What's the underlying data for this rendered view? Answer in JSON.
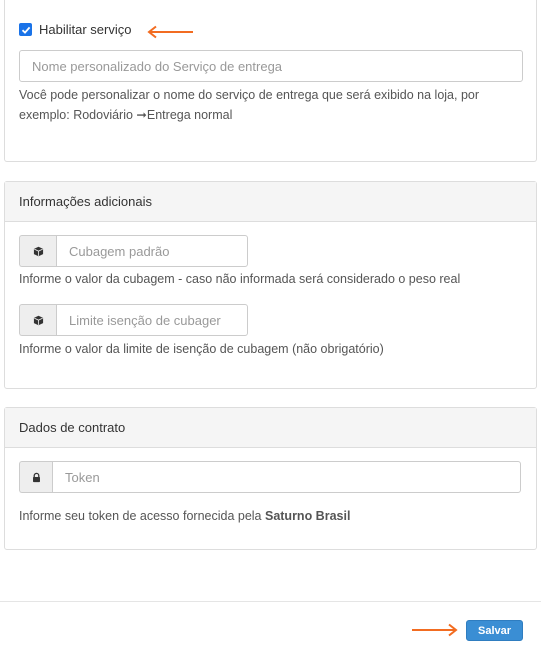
{
  "service": {
    "enable_label": "Habilitar serviço",
    "enabled": true,
    "name_placeholder": "Nome personalizado do Serviço de entrega",
    "name_help_line1": "Você pode personalizar o nome do serviço de entrega que será exibido na loja, por",
    "name_help_line2": "exemplo: Rodoviário ➞Entrega normal"
  },
  "additional": {
    "title": "Informações adicionais",
    "cubage_placeholder": "Cubagem padrão",
    "cubage_help": "Informe o valor da cubagem - caso não informada será considerado o peso real",
    "exemption_placeholder": "Limite isenção de cubager",
    "exemption_help": "Informe o valor da limite de isenção de cubagem (não obrigatório)",
    "icon": "cube-icon"
  },
  "contract": {
    "title": "Dados de contrato",
    "token_placeholder": "Token",
    "token_help_prefix": "Informe seu token de acesso fornecida pela ",
    "token_help_brand": "Saturno Brasil",
    "icon": "lock-icon"
  },
  "footer": {
    "save_label": "Salvar"
  },
  "colors": {
    "accent_arrow": "#f26c21",
    "button": "#3a8ed4",
    "checkbox": "#1a73e8"
  }
}
